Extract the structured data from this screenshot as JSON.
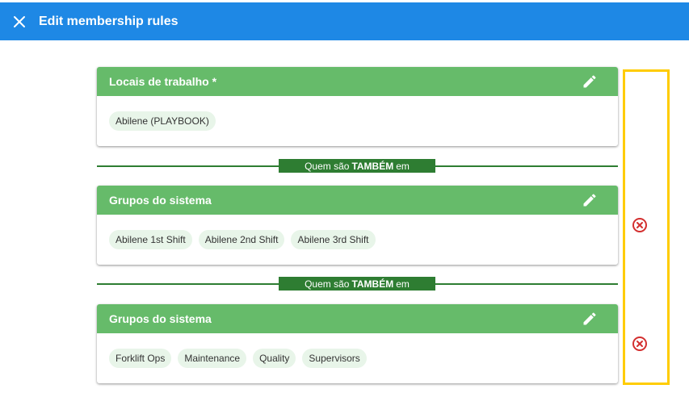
{
  "header": {
    "title": "Edit membership rules",
    "close_icon": "close-icon",
    "background": "#1e88e5"
  },
  "rules": [
    {
      "title": "Locais de trabalho *",
      "chips": [
        "Abilene (PLAYBOOK)"
      ]
    },
    {
      "title": "Grupos do sistema",
      "chips": [
        "Abilene 1st Shift",
        "Abilene 2nd Shift",
        "Abilene 3rd Shift"
      ]
    },
    {
      "title": "Grupos do sistema",
      "chips": [
        "Forklift Ops",
        "Maintenance",
        "Quality",
        "Supervisors"
      ]
    }
  ],
  "connector": {
    "prefix": "Quem são",
    "emphasis": "TAMBÉM",
    "suffix": "em"
  },
  "colors": {
    "card_header": "#66bb6a",
    "connector": "#2e7d32",
    "chip_bg": "#e8f5e9",
    "remove_icon": "#d32f2f",
    "highlight_border": "#ffcc00"
  }
}
